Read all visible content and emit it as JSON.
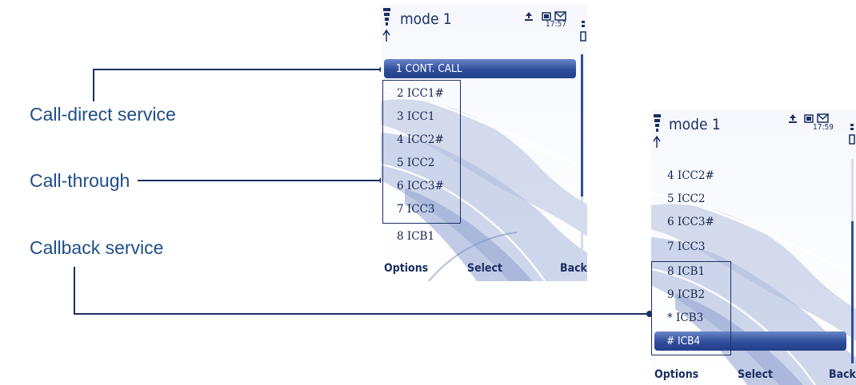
{
  "callouts": {
    "call_direct": "Call-direct service",
    "call_through": "Call-through",
    "callback": "Callback service"
  },
  "phone1": {
    "title": "mode 1",
    "time": "17:57",
    "items": [
      "1 CONT. CALL",
      "2 ICC1#",
      "3 ICC1",
      "4 ICC2#",
      "5 ICC2",
      "6 ICC3#",
      "7 ICC3",
      "8 ICB1"
    ],
    "softkeys": {
      "left": "Options",
      "middle": "Select",
      "right": "Back"
    }
  },
  "phone2": {
    "title": "mode 1",
    "time": "17:59",
    "items": [
      "4 ICC2#",
      "5 ICC2",
      "6 ICC3#",
      "7 ICC3",
      "8 ICB1",
      "9 ICB2",
      "* ICB3",
      "# ICB4"
    ],
    "softkeys": {
      "left": "Options",
      "middle": "Select",
      "right": "Back"
    }
  },
  "colors": {
    "accent": "#1f4d86",
    "selection": "#2f4d9c"
  },
  "icons": [
    "signal-icon",
    "upload-icon",
    "memory-card-icon",
    "envelope-icon",
    "battery-icon"
  ]
}
